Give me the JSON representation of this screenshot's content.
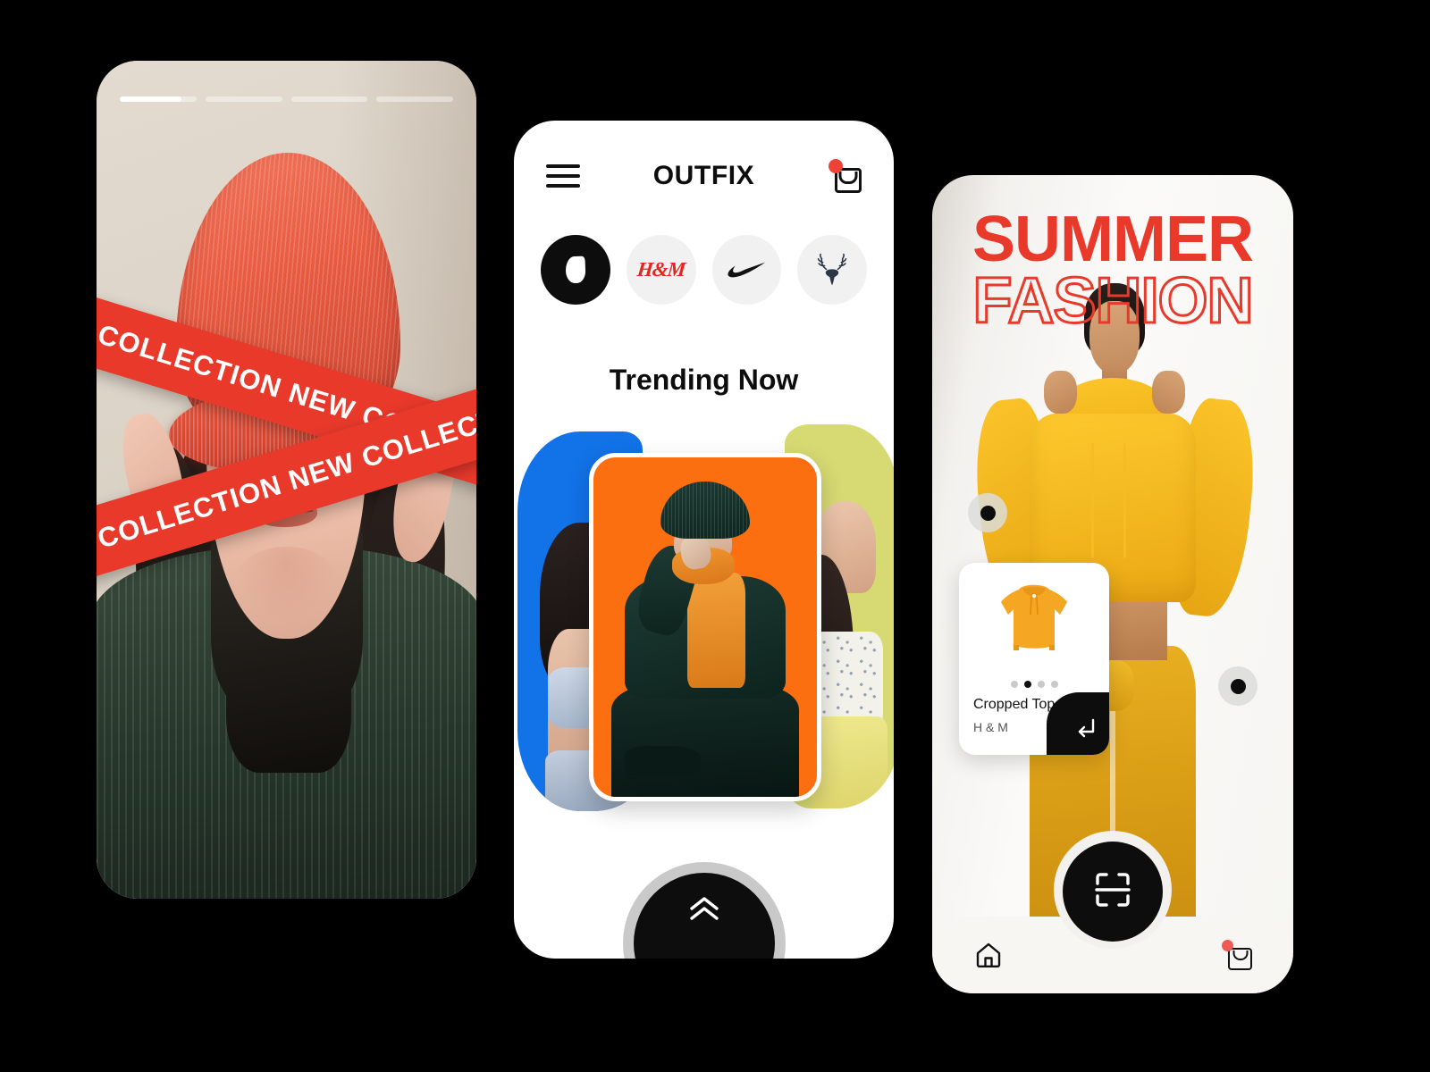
{
  "app": {
    "name": "OUTFIX",
    "accent_red": "#e8392b",
    "accent_orange": "#fb6f10",
    "accent_blue": "#1272e8",
    "accent_lime": "#d7da72",
    "accent_yellow": "#e9b021",
    "dark": "#0d0d0d"
  },
  "screen1": {
    "name": "story-screen",
    "story_progress": [
      {
        "label": "story-1",
        "percent": 80
      },
      {
        "label": "story-2",
        "percent": 0
      },
      {
        "label": "story-3",
        "percent": 0
      },
      {
        "label": "story-4",
        "percent": 0
      }
    ],
    "ribbon": {
      "text_repeat": "NEW COLLECTION",
      "line_a": "NEW COLLECTION   NEW COLLECTION   NEW COLLECTION   NEW COLLECTION",
      "line_b": "NEW COLLECTION   NEW COLLECTION   NEW COLLECTION   NEW COLLECTION",
      "color": "#e8392b"
    },
    "photo_alt": "Model in orange beanie pulled over eyes and green knit sweater"
  },
  "screen2": {
    "name": "home-screen",
    "header": {
      "menu_icon": "hamburger-menu-icon",
      "title": "OUTFIX",
      "bag_icon": "shopping-bag-icon",
      "bag_has_badge": true
    },
    "brand_chips": [
      {
        "id": "trending",
        "icon": "flame-icon",
        "label": "Trending",
        "active": true
      },
      {
        "id": "hm",
        "icon": "hm-logo",
        "label": "H&M",
        "active": false
      },
      {
        "id": "nike",
        "icon": "nike-swoosh-logo",
        "label": "Nike",
        "active": false
      },
      {
        "id": "stag",
        "icon": "stag-head-logo",
        "label": "Abercrombie",
        "active": false
      }
    ],
    "section_title": "Trending Now",
    "carousel": [
      {
        "position": "left",
        "color": "#1272e8",
        "alt": "Model in light blue top"
      },
      {
        "position": "center",
        "color": "#fb6f10",
        "alt": "Model in green jacket and orange hoodie with beanie",
        "active": true
      },
      {
        "position": "right",
        "color": "#d7da72",
        "alt": "Model in floral top and yellow pants"
      }
    ],
    "fab": {
      "icon": "double-chevron-up-icon",
      "label": "Expand"
    }
  },
  "screen3": {
    "name": "summer-fashion-screen",
    "headline_line1": "SUMMER",
    "headline_line2": "FASHION",
    "product_card": {
      "name": "Cropped Top",
      "brand": "H & M",
      "image_alt": "Yellow cropped hoodie product shot",
      "pagination": {
        "count": 4,
        "active_index": 1
      },
      "action_icon": "enter-arrow-icon"
    },
    "side_handles": [
      {
        "position": "left",
        "name": "prev-handle"
      },
      {
        "position": "right",
        "name": "next-handle"
      }
    ],
    "bottom_nav": {
      "home_icon": "home-icon",
      "scan_icon": "scan-icon",
      "bag_icon": "shopping-bag-icon",
      "bag_has_badge": true
    },
    "model_alt": "Model wearing yellow cropped hoodie and yellow sweatpants"
  }
}
